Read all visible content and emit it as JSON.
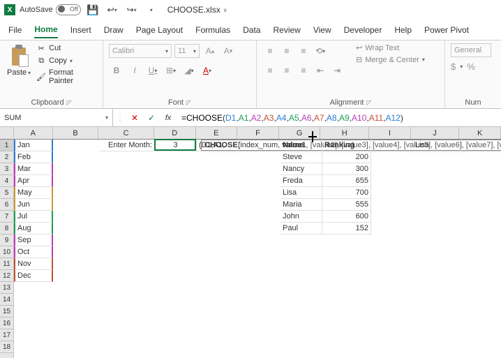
{
  "titlebar": {
    "autosave_label": "AutoSave",
    "autosave_state": "Off",
    "filename": "CHOOSE.xlsx"
  },
  "tabs": {
    "file": "File",
    "home": "Home",
    "insert": "Insert",
    "draw": "Draw",
    "page_layout": "Page Layout",
    "formulas": "Formulas",
    "data": "Data",
    "review": "Review",
    "view": "View",
    "developer": "Developer",
    "help": "Help",
    "power_pivot": "Power Pivot"
  },
  "ribbon": {
    "clipboard": {
      "label": "Clipboard",
      "paste": "Paste",
      "cut": "Cut",
      "copy": "Copy",
      "format_painter": "Format Painter"
    },
    "font": {
      "label": "Font",
      "name": "Calibri",
      "size": "11",
      "bold": "B",
      "italic": "I",
      "underline": "U"
    },
    "alignment": {
      "label": "Alignment",
      "wrap": "Wrap Text",
      "merge": "Merge & Center"
    },
    "number": {
      "label": "Num",
      "format": "General",
      "currency": "$",
      "percent": "%"
    }
  },
  "namebox": "SUM",
  "formula": {
    "fn": "=CHOOSE",
    "open": "(",
    "args": [
      "D1",
      "A1",
      "A2",
      "A3",
      "A4",
      "A5",
      "A6",
      "A7",
      "A8",
      "A9",
      "A10",
      "A11",
      "A12"
    ],
    "close": ")"
  },
  "tooltip": {
    "fn": "CHOOSE(",
    "a0": "index_num",
    "a1": "value1",
    "opts": ", [value2], [value3], [value4], [value5], [value6], [value7], [val"
  },
  "col_widths": {
    "A": 56,
    "B": 66,
    "C": 80,
    "D": 60,
    "E": 60,
    "F": 60,
    "G": 60,
    "H": 70,
    "I": 60,
    "J": 70,
    "K": 60
  },
  "months": [
    "Jan",
    "Feb",
    "Mar",
    "Apr",
    "May",
    "Jun",
    "Jul",
    "Aug",
    "Sep",
    "Oct",
    "Nov",
    "Dec"
  ],
  "month_border_colors": [
    "#2b7cd3",
    "#2b7cd3",
    "#b93bb5",
    "#b93bb5",
    "#c59b2d",
    "#c59b2d",
    "#1a9c52",
    "#1a9c52",
    "#b93bb5",
    "#b93bb5",
    "#c05030",
    "#c05030"
  ],
  "cells": {
    "C1": "Enter Month:",
    "D1": "3",
    "E1_editing": "(D1,A1,",
    "G1": "Name",
    "H1": "Ranking",
    "J1": "Lisa"
  },
  "table": [
    {
      "name": "Steve",
      "rank": 200
    },
    {
      "name": "Nancy",
      "rank": 300
    },
    {
      "name": "Freda",
      "rank": 655
    },
    {
      "name": "Lisa",
      "rank": 700
    },
    {
      "name": "Maria",
      "rank": 555
    },
    {
      "name": "John",
      "rank": 600
    },
    {
      "name": "Paul",
      "rank": 152
    }
  ],
  "chart_data": {
    "type": "table",
    "title": "Name / Ranking",
    "columns": [
      "Name",
      "Ranking"
    ],
    "rows": [
      [
        "Steve",
        200
      ],
      [
        "Nancy",
        300
      ],
      [
        "Freda",
        655
      ],
      [
        "Lisa",
        700
      ],
      [
        "Maria",
        555
      ],
      [
        "John",
        600
      ],
      [
        "Paul",
        152
      ]
    ]
  }
}
